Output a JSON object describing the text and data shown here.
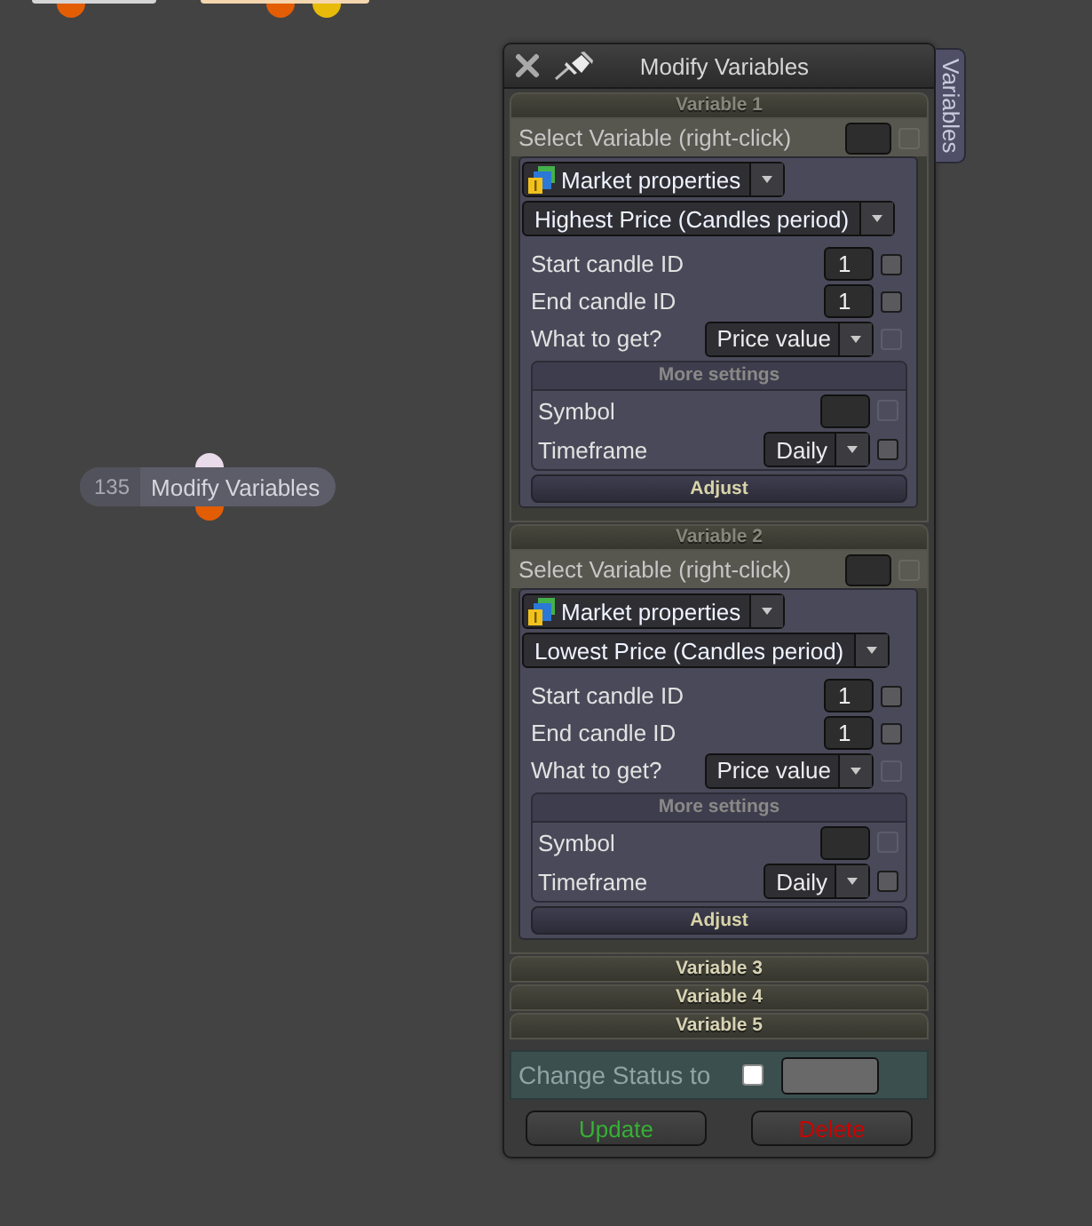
{
  "canvas": {
    "nodes": [
      {
        "color": "#d6d6d6",
        "ports": [
          {
            "kind": "output",
            "color": "#e35d05"
          }
        ]
      },
      {
        "color": "#f4d7ae",
        "ports": [
          {
            "kind": "output",
            "color": "#e35d05"
          },
          {
            "kind": "output",
            "color": "#e8bb0a"
          }
        ]
      },
      {
        "number": "135",
        "title": "Modify Variables",
        "color": "#5d5d69",
        "ports": [
          {
            "kind": "input",
            "color": "#e9dbe9"
          },
          {
            "kind": "output",
            "color": "#e35d05"
          }
        ]
      }
    ]
  },
  "panel": {
    "title": "Modify Variables",
    "side_tab": "Variables",
    "variables": [
      {
        "title": "Variable 1",
        "expanded": true,
        "selector": {
          "label": "Select Variable (right-click)",
          "checked": false,
          "disabled": true
        },
        "category": "Market properties",
        "function": "Highest Price (Candles period)",
        "params": [
          {
            "kind": "number",
            "label": "Start candle ID",
            "value": "1",
            "checked": false,
            "disabled": false
          },
          {
            "kind": "number",
            "label": "End candle ID",
            "value": "1",
            "checked": false,
            "disabled": false
          },
          {
            "kind": "dropdown",
            "label": "What to get?",
            "value": "Price value",
            "checked": false,
            "disabled": true
          }
        ],
        "more_settings": {
          "title": "More settings",
          "expanded": true,
          "params": [
            {
              "kind": "text",
              "label": "Symbol",
              "checked": false,
              "disabled": true
            },
            {
              "kind": "dropdown",
              "label": "Timeframe",
              "value": "Daily",
              "checked": false,
              "disabled": false
            }
          ]
        },
        "adjust": "Adjust"
      },
      {
        "title": "Variable 2",
        "expanded": true,
        "selector": {
          "label": "Select Variable (right-click)",
          "checked": false,
          "disabled": true
        },
        "category": "Market properties",
        "function": "Lowest Price (Candles period)",
        "params": [
          {
            "kind": "number",
            "label": "Start candle ID",
            "value": "1",
            "checked": false,
            "disabled": false
          },
          {
            "kind": "number",
            "label": "End candle ID",
            "value": "1",
            "checked": false,
            "disabled": false
          },
          {
            "kind": "dropdown",
            "label": "What to get?",
            "value": "Price value",
            "checked": false,
            "disabled": true
          }
        ],
        "more_settings": {
          "title": "More settings",
          "expanded": true,
          "params": [
            {
              "kind": "text",
              "label": "Symbol",
              "checked": false,
              "disabled": true
            },
            {
              "kind": "dropdown",
              "label": "Timeframe",
              "value": "Daily",
              "checked": false,
              "disabled": false
            }
          ]
        },
        "adjust": "Adjust"
      },
      {
        "title": "Variable 3",
        "expanded": false
      },
      {
        "title": "Variable 4",
        "expanded": false
      },
      {
        "title": "Variable 5",
        "expanded": false
      }
    ],
    "status": {
      "label": "Change Status to",
      "checked": false
    },
    "buttons": [
      {
        "kind": "update",
        "label": "Update"
      },
      {
        "kind": "delete",
        "label": "Delete"
      }
    ]
  }
}
